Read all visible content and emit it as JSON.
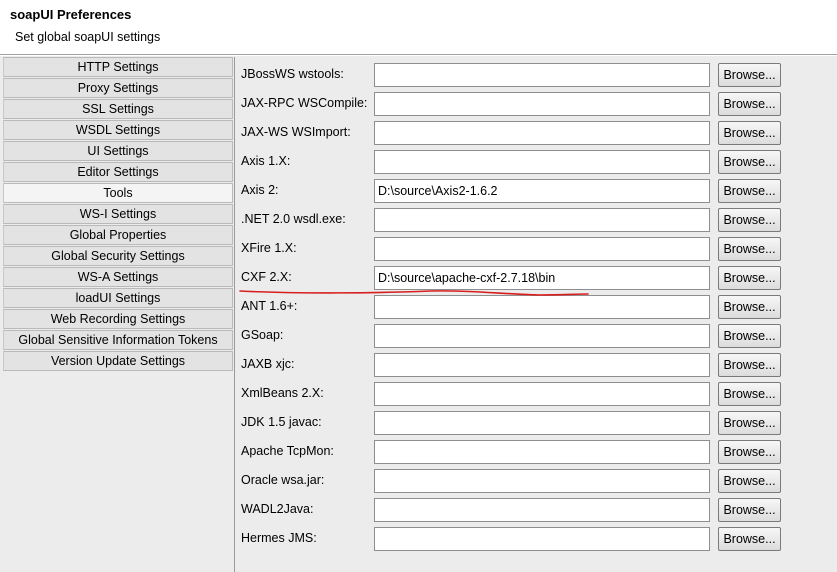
{
  "window": {
    "title": "soapUI Preferences",
    "subtitle": "Set global soapUI settings"
  },
  "sidebar": {
    "active_index": 6,
    "items": [
      {
        "label": "HTTP Settings"
      },
      {
        "label": "Proxy Settings"
      },
      {
        "label": "SSL Settings"
      },
      {
        "label": "WSDL Settings"
      },
      {
        "label": "UI Settings"
      },
      {
        "label": "Editor Settings"
      },
      {
        "label": "Tools"
      },
      {
        "label": "WS-I Settings"
      },
      {
        "label": "Global Properties"
      },
      {
        "label": "Global Security Settings"
      },
      {
        "label": "WS-A Settings"
      },
      {
        "label": "loadUI Settings"
      },
      {
        "label": "Web Recording Settings"
      },
      {
        "label": "Global Sensitive Information Tokens"
      },
      {
        "label": "Version Update Settings"
      }
    ]
  },
  "tools": {
    "browse_label": "Browse...",
    "rows": [
      {
        "label": "JBossWS wstools:",
        "value": ""
      },
      {
        "label": "JAX-RPC WSCompile:",
        "value": ""
      },
      {
        "label": "JAX-WS WSImport:",
        "value": ""
      },
      {
        "label": "Axis 1.X:",
        "value": ""
      },
      {
        "label": "Axis 2:",
        "value": "D:\\source\\Axis2-1.6.2"
      },
      {
        "label": ".NET 2.0 wsdl.exe:",
        "value": ""
      },
      {
        "label": "XFire 1.X:",
        "value": ""
      },
      {
        "label": "CXF 2.X:",
        "value": "D:\\source\\apache-cxf-2.7.18\\bin"
      },
      {
        "label": "ANT 1.6+:",
        "value": ""
      },
      {
        "label": "GSoap:",
        "value": ""
      },
      {
        "label": "JAXB xjc:",
        "value": ""
      },
      {
        "label": "XmlBeans 2.X:",
        "value": ""
      },
      {
        "label": "JDK 1.5 javac:",
        "value": ""
      },
      {
        "label": "Apache TcpMon:",
        "value": ""
      },
      {
        "label": "Oracle wsa.jar:",
        "value": ""
      },
      {
        "label": "WADL2Java:",
        "value": ""
      },
      {
        "label": "Hermes JMS:",
        "value": ""
      }
    ]
  },
  "annotation": {
    "color": "#d81e1e"
  }
}
